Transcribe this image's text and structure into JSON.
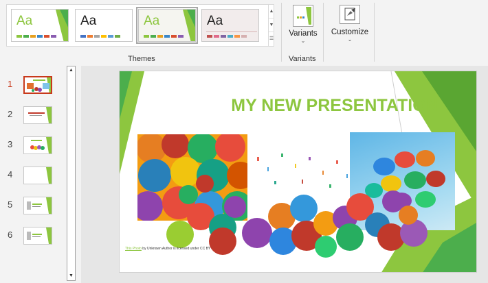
{
  "ribbon": {
    "themes": {
      "group_label": "Themes",
      "tiles": [
        {
          "sample": "Aa",
          "selected": false,
          "palette": [
            "#8dc63f",
            "#4cae4c",
            "#e6a020",
            "#3a87c8",
            "#d94f2e",
            "#8a5cb0"
          ]
        },
        {
          "sample": "Aa",
          "selected": false,
          "palette": [
            "#4472c4",
            "#ed7d31",
            "#a5a5a5",
            "#ffc000",
            "#5b9bd5",
            "#70ad47"
          ]
        },
        {
          "sample": "Aa",
          "selected": true,
          "palette": [
            "#8dc63f",
            "#4cae4c",
            "#e6a020",
            "#3a87c8",
            "#d94f2e",
            "#8a5cb0"
          ]
        },
        {
          "sample": "Aa",
          "selected": false,
          "palette": [
            "#c0504d",
            "#e06a8a",
            "#8064a2",
            "#4bacc6",
            "#f79646",
            "#d6b0b0"
          ]
        }
      ]
    },
    "variants": {
      "button_label": "Variants",
      "group_label": "Variants"
    },
    "customize": {
      "button_label": "Customize"
    }
  },
  "thumbnails": [
    {
      "number": "1",
      "active": true
    },
    {
      "number": "2",
      "active": false
    },
    {
      "number": "3",
      "active": false
    },
    {
      "number": "4",
      "active": false
    },
    {
      "number": "5",
      "active": false
    },
    {
      "number": "6",
      "active": false
    }
  ],
  "slide": {
    "title": "MY NEW PRESENTATION",
    "caption_link": "This Photo",
    "caption_rest": " by Unknown Author is licensed under CC BY"
  },
  "colors": {
    "accent": "#8dc63f",
    "active_thumb": "#c8391b"
  }
}
